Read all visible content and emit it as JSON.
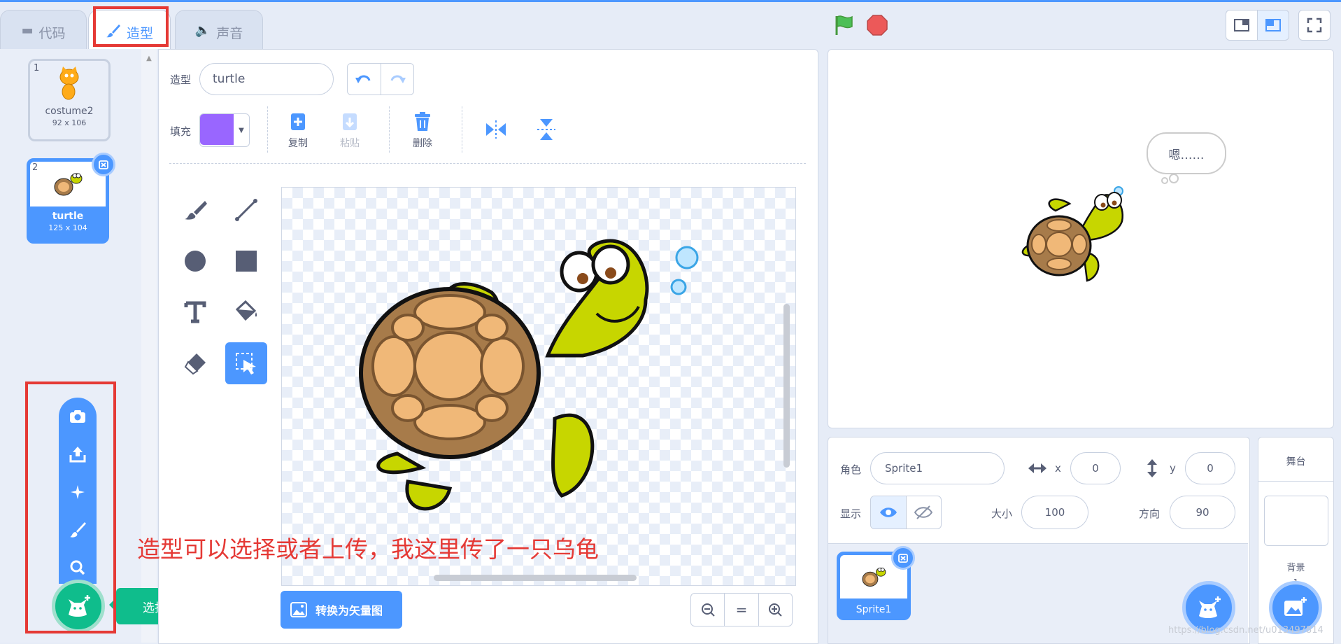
{
  "tabs": {
    "code": "代码",
    "costumes": "造型",
    "sounds": "声音"
  },
  "costumes": [
    {
      "index": "1",
      "name": "costume2",
      "size": "92 x 106"
    },
    {
      "index": "2",
      "name": "turtle",
      "size": "125 x 104"
    }
  ],
  "editor": {
    "costume_label": "造型",
    "costume_name": "turtle",
    "fill_label": "填充",
    "fill_color": "#9966ff",
    "copy": "复制",
    "paste": "粘贴",
    "delete": "删除",
    "convert_vector": "转换为矢量图"
  },
  "annotation": "造型可以选择或者上传，我这里传了一只乌龟",
  "choose_costume_tooltip": "选择一个造型",
  "stage": {
    "speech": "嗯……"
  },
  "sprite_info": {
    "sprite_label": "角色",
    "sprite_name": "Sprite1",
    "x_label": "x",
    "x_value": "0",
    "y_label": "y",
    "y_value": "0",
    "show_label": "显示",
    "size_label": "大小",
    "size_value": "100",
    "direction_label": "方向",
    "direction_value": "90"
  },
  "sprites": [
    {
      "name": "Sprite1"
    }
  ],
  "stage_panel": {
    "title": "舞台",
    "backdrop_label": "背景",
    "backdrop_count": "1"
  },
  "watermark": "https://blog.csdn.net/u013497814"
}
